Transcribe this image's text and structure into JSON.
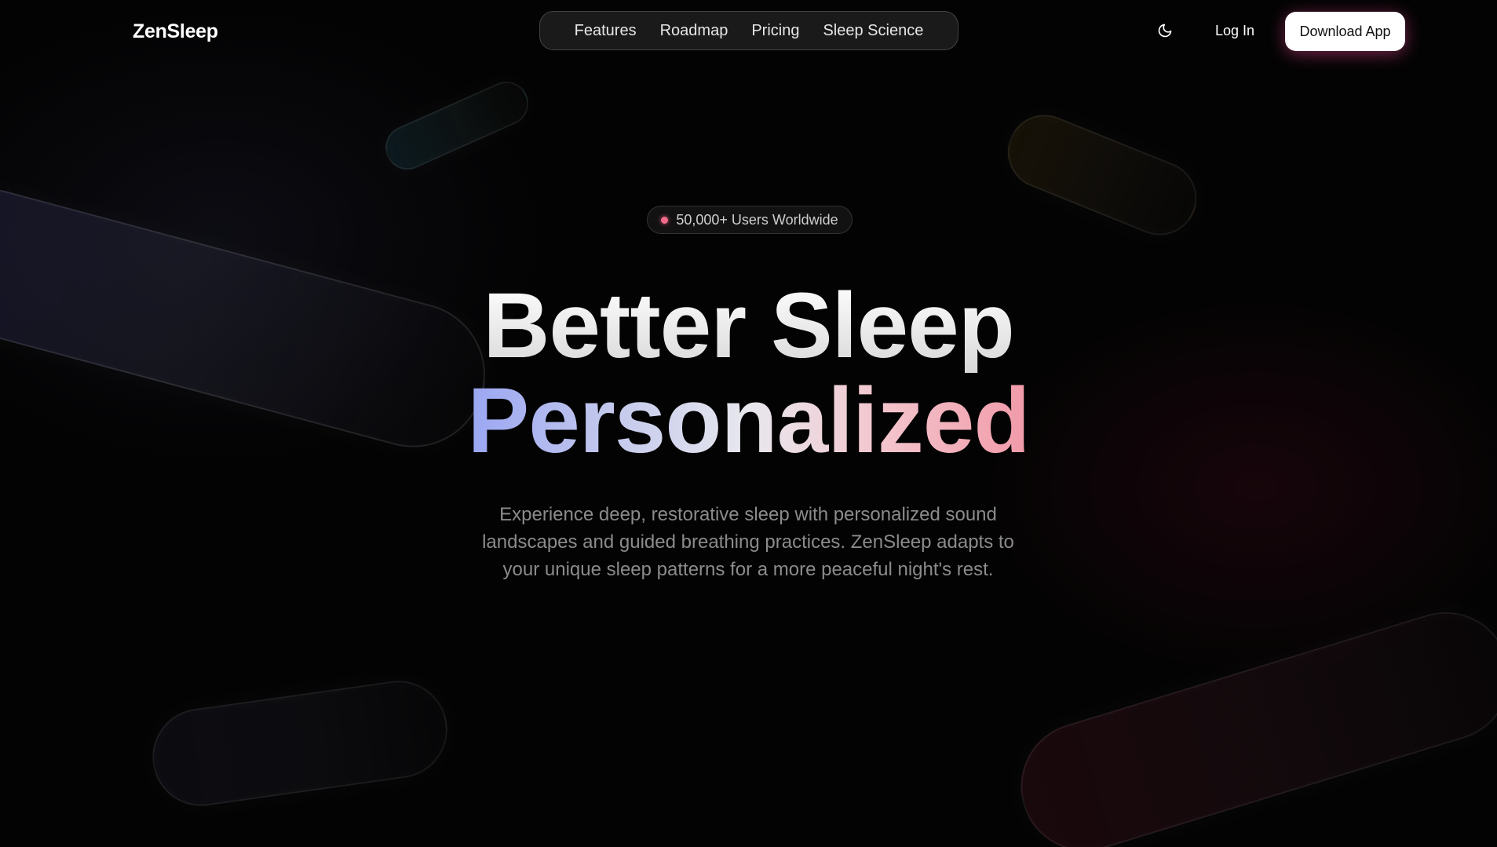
{
  "header": {
    "logo": "ZenSleep",
    "nav": [
      {
        "label": "Features"
      },
      {
        "label": "Roadmap"
      },
      {
        "label": "Pricing"
      },
      {
        "label": "Sleep Science"
      }
    ],
    "theme_icon": "moon-icon",
    "login_label": "Log In",
    "download_label": "Download App"
  },
  "hero": {
    "badge": "50,000+ Users Worldwide",
    "headline_line1": "Better Sleep",
    "headline_line2": "Personalized",
    "subtitle": "Experience deep, restorative sleep with personalized sound landscapes and guided breathing practices. ZenSleep adapts to your unique sleep patterns for a more peaceful night's rest."
  },
  "colors": {
    "background": "#030303",
    "badge_dot": "#f06a8a",
    "gradient_start": "#9aa6f3",
    "gradient_end": "#f19aa8",
    "download_glow": "#ff50a0"
  }
}
